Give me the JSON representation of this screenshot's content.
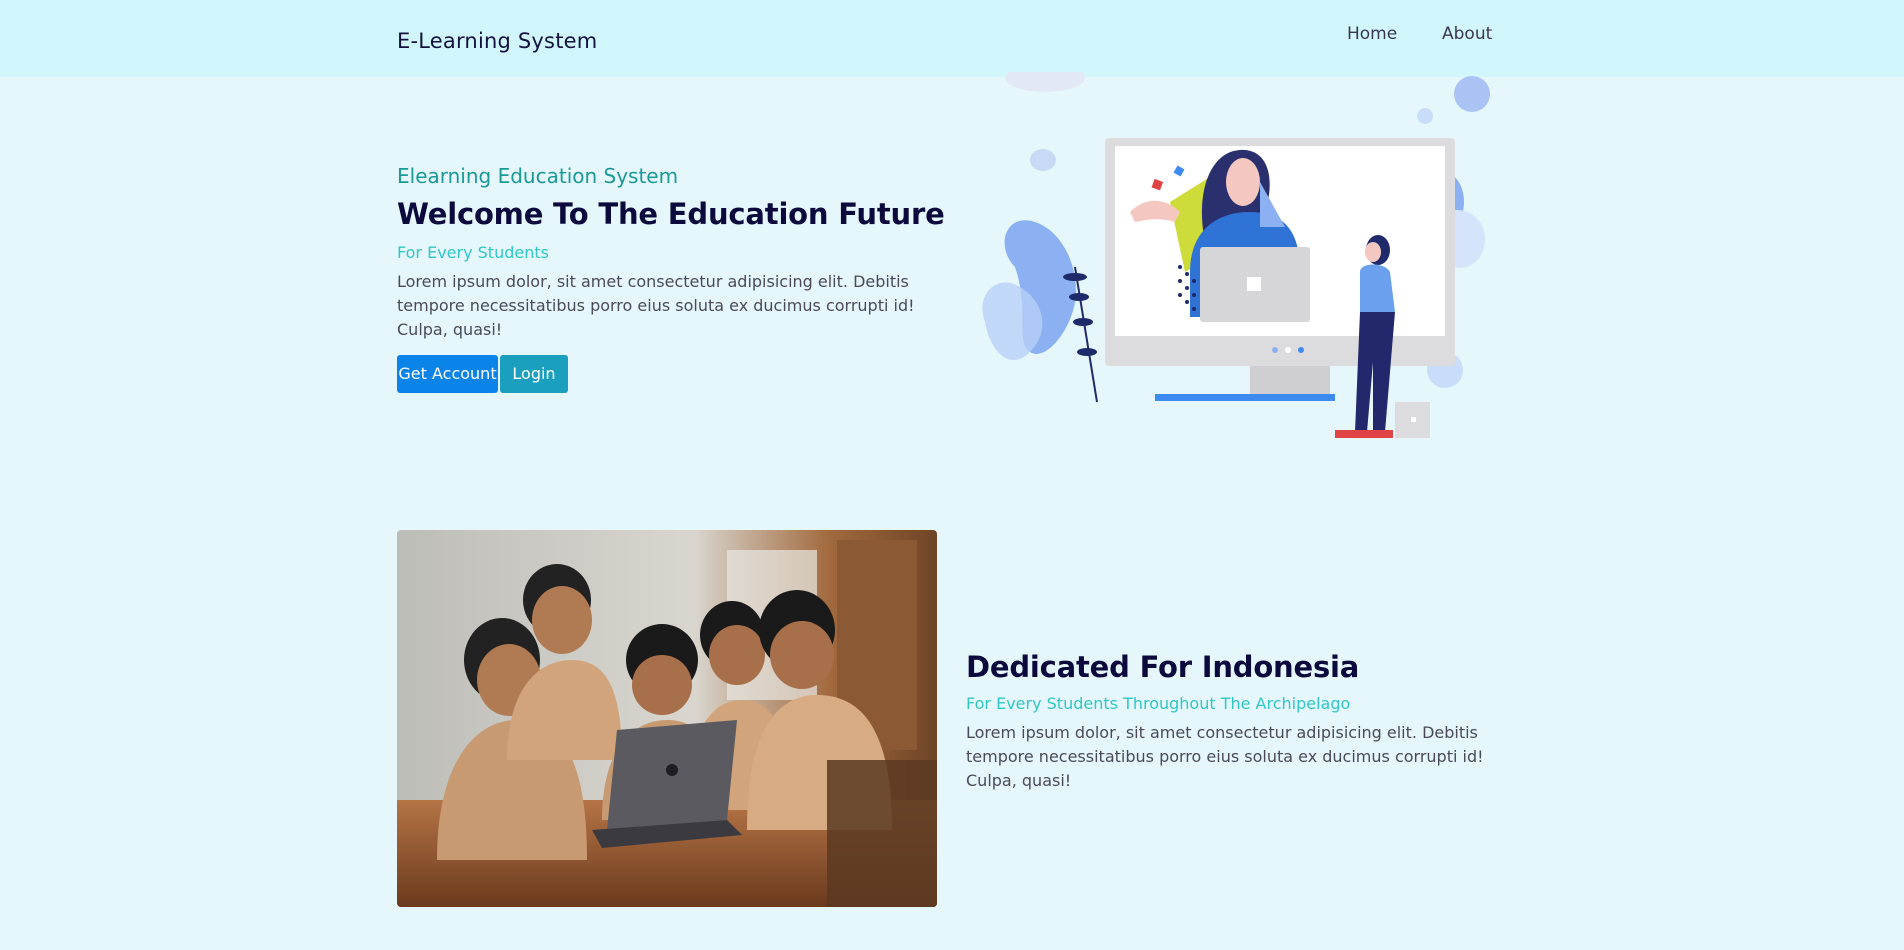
{
  "navbar": {
    "brand": "E-Learning System",
    "links": [
      {
        "label": "Home"
      },
      {
        "label": "About"
      }
    ]
  },
  "hero": {
    "eyebrow": "Elearning Education System",
    "title": "Welcome To The Education Future",
    "subtitle": "For Every Students",
    "body": "Lorem ipsum dolor, sit amet consectetur adipisicing elit. Debitis tempore necessitatibus porro eius soluta ex ducimus corrupti id! Culpa, quasi!",
    "buttons": {
      "get_account": "Get Account",
      "login": "Login"
    }
  },
  "section2": {
    "title": "Dedicated For Indonesia",
    "subtitle": "For Every Students Throughout The Archipelago",
    "body": "Lorem ipsum dolor, sit amet consectetur adipisicing elit. Debitis tempore necessitatibus porro eius soluta ex ducimus corrupti id! Culpa, quasi!"
  },
  "colors": {
    "page_bg": "#e6f7fc",
    "navbar_bg": "#d1f7fc",
    "primary_button": "#0a84e8",
    "login_button": "#1a9fbf",
    "teal_text": "#199a96",
    "cyan_text": "#2fc7c7",
    "heading": "#0c0a3d"
  },
  "icons": [
    "teacher-monitor-illustration",
    "students-laptop-photo"
  ]
}
